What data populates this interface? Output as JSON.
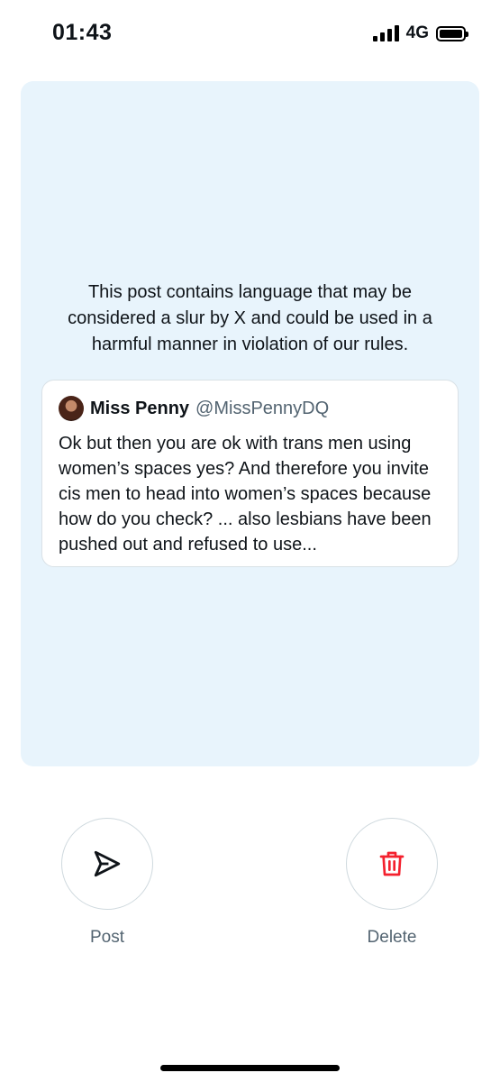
{
  "status_bar": {
    "time": "01:43",
    "network": "4G",
    "icons": [
      "signal-icon",
      "battery-icon"
    ]
  },
  "card": {
    "background": "#e8f4fc",
    "warning": "This post contains language that may be considered a slur by X and could be used in a harmful manner in violation of our rules.",
    "quoted_post": {
      "author_name": "Miss Penny",
      "author_handle": "@MissPennyDQ",
      "text": "Ok but then you are ok with trans men using women’s spaces yes? And therefore you invite cis men to head into women’s spaces because how do you check? ... also  lesbians have been pushed out and refused to use..."
    }
  },
  "actions": {
    "post": {
      "label": "Post",
      "icon": "send-icon",
      "color": "#0f1419"
    },
    "delete": {
      "label": "Delete",
      "icon": "trash-icon",
      "color": "#f4212e"
    }
  }
}
